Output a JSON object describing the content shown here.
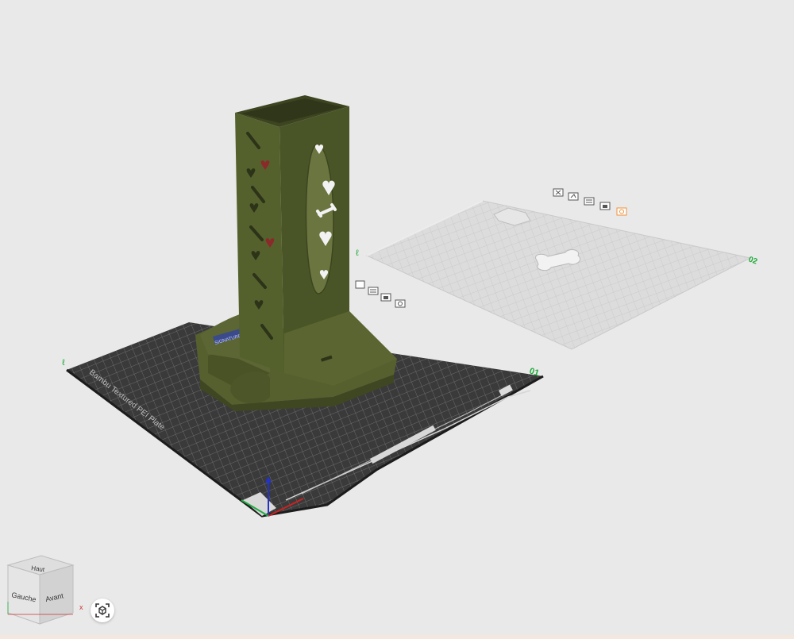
{
  "app": {
    "view": "3D Prepare"
  },
  "plates": [
    {
      "number": "01",
      "marker": "ℓ",
      "name": "Bambu Textured PEI Plate",
      "status": "active",
      "icons": [
        "delete-icon",
        "orient-icon",
        "arrange-icon",
        "lock-icon",
        "settings-icon"
      ]
    },
    {
      "number": "02",
      "marker": "ℓ",
      "status": "inactive",
      "icons": [
        "delete-icon",
        "orient-icon",
        "arrange-icon",
        "lock-icon",
        "settings-icon"
      ]
    }
  ],
  "model_label": "SIGNATURE",
  "nav_cube": {
    "top": "Haut",
    "left": "Gauche",
    "front": "Avant",
    "x_axis": "x"
  },
  "colors": {
    "background": "#e9e9e9",
    "model": "#4f5a2b",
    "plate_active": "#3b3b3b",
    "plate_inactive": "#dcdcdc",
    "accent_green": "#1eaa3a",
    "axis_x": "#cc2222",
    "axis_y": "#22aa44",
    "axis_z": "#2233cc"
  }
}
